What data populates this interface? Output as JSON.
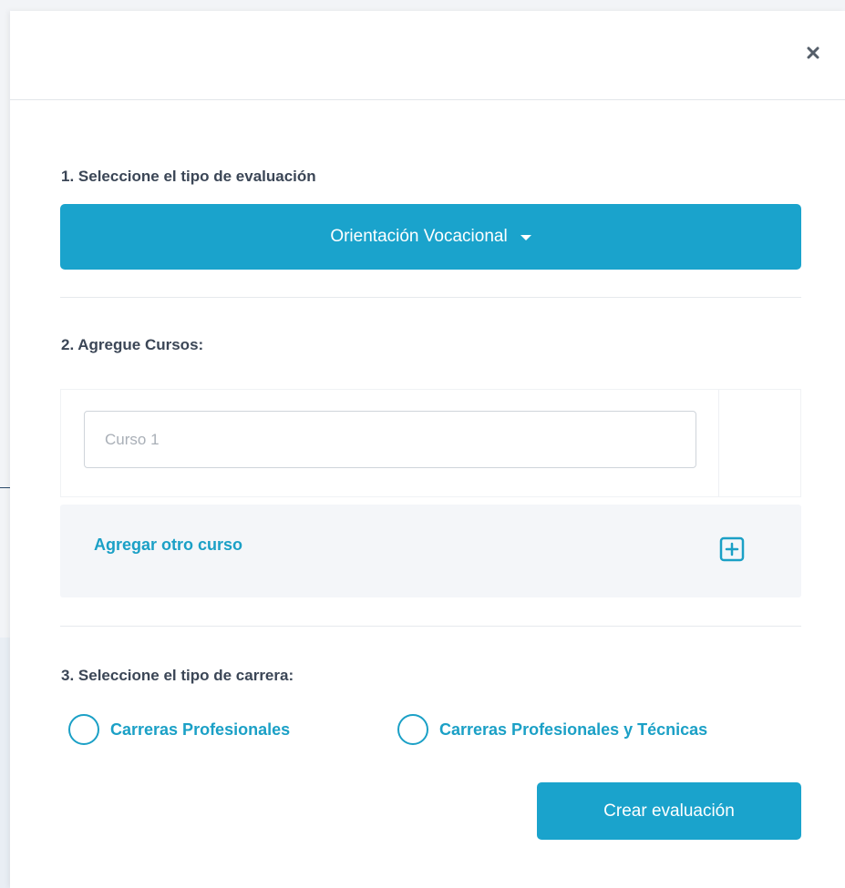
{
  "modal": {
    "close_icon": "close-icon"
  },
  "step1": {
    "label": "1. Seleccione el tipo de evaluación",
    "dropdown_value": "Orientación Vocacional",
    "dropdown_icon": "caret-down-icon"
  },
  "step2": {
    "label": "2. Agregue Cursos:",
    "course_input": {
      "placeholder": "Curso 1",
      "value": ""
    },
    "add_course_label": "Agregar otro curso",
    "add_icon": "plus-square-icon"
  },
  "step3": {
    "label": "3. Seleccione el tipo de carrera:",
    "options": [
      {
        "label": "Carreras Profesionales",
        "selected": false
      },
      {
        "label": "Carreras Profesionales y Técnicas",
        "selected": false
      }
    ]
  },
  "actions": {
    "submit_label": "Crear evaluación"
  },
  "colors": {
    "accent": "#1aa3cc",
    "text_dark": "#3b4656",
    "panel_bg": "#f4f6f9"
  }
}
